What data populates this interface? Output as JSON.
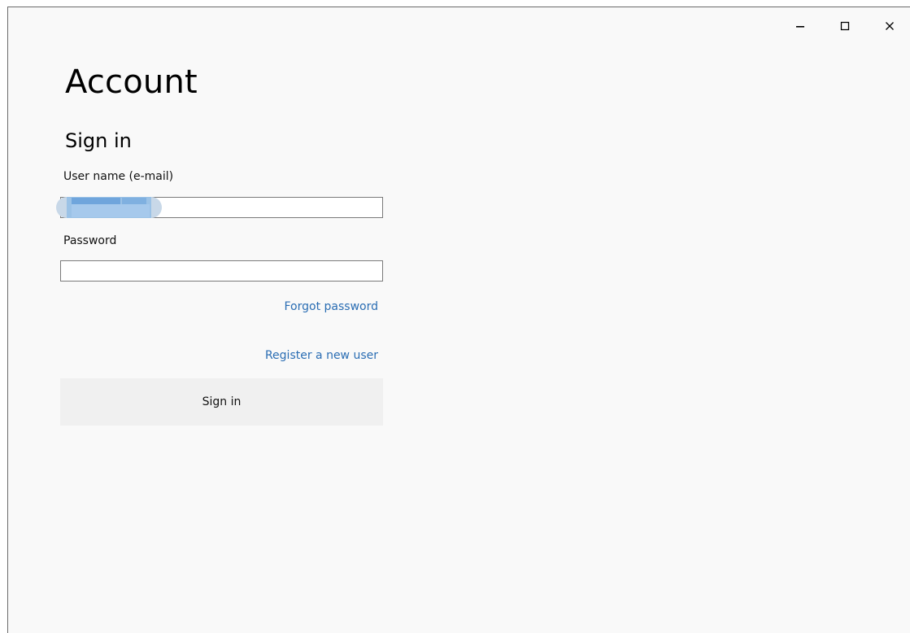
{
  "window": {
    "caption_buttons": {
      "minimize_icon": "minimize-icon",
      "maximize_icon": "maximize-icon",
      "close_icon": "close-icon"
    }
  },
  "header": {
    "title": "Account"
  },
  "sign_in": {
    "heading": "Sign in",
    "username_label": "User name (e-mail)",
    "username_value": "",
    "password_label": "Password",
    "password_value": "",
    "forgot_password": "Forgot password",
    "register": "Register a new user",
    "submit_label": "Sign in"
  },
  "colors": {
    "background": "#f9f9f9",
    "link": "#2a6db3",
    "button_bg": "#f0f0f0"
  }
}
